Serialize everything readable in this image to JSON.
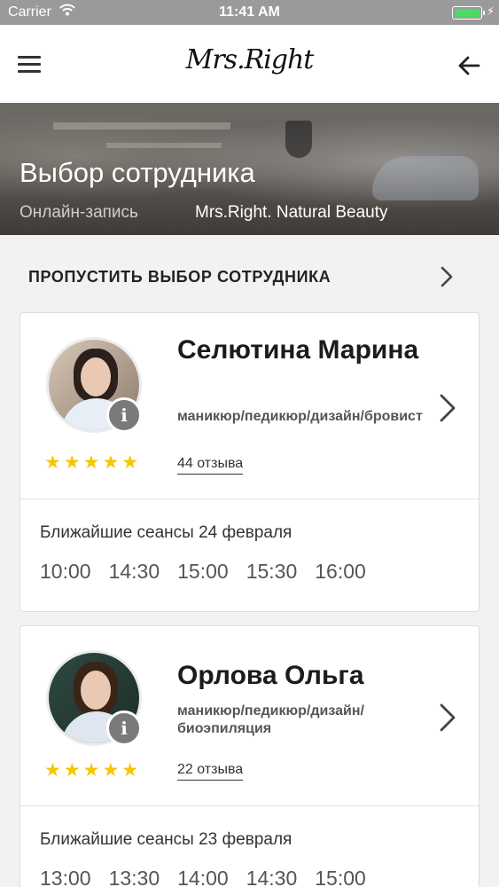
{
  "status_bar": {
    "carrier": "Carrier",
    "time": "11:41 AM"
  },
  "nav": {
    "logo": "Mrs.Right",
    "menu_icon": "menu-icon",
    "back_icon": "arrow-left-icon"
  },
  "hero": {
    "title": "Выбор сотрудника",
    "subtitle": "Онлайн-запись",
    "salon": "Mrs.Right. Natural Beauty"
  },
  "skip": {
    "label": "ПРОПУСТИТЬ ВЫБОР СОТРУДНИКА"
  },
  "employees": [
    {
      "name": "Селютина Марина",
      "specialty": "маникюр/педикюр/дизайн/бровист",
      "rating_stars": 5,
      "stars_text": "★★★★★",
      "reviews": "44 отзыва",
      "info_label": "i",
      "sessions_title": "Ближайшие сеансы 24 февраля",
      "slots": [
        "10:00",
        "14:30",
        "15:00",
        "15:30",
        "16:00"
      ]
    },
    {
      "name": "Орлова Ольга",
      "specialty": "маникюр/педикюр/дизайн/биоэпиляция",
      "rating_stars": 5,
      "stars_text": "★★★★★",
      "reviews": "22 отзыва",
      "info_label": "i",
      "sessions_title": "Ближайшие сеансы 23 февраля",
      "slots": [
        "13:00",
        "13:30",
        "14:00",
        "14:30",
        "15:00"
      ]
    }
  ],
  "colors": {
    "star": "#f6c600",
    "status_bar": "#9a9a9a",
    "battery": "#4cd964"
  }
}
